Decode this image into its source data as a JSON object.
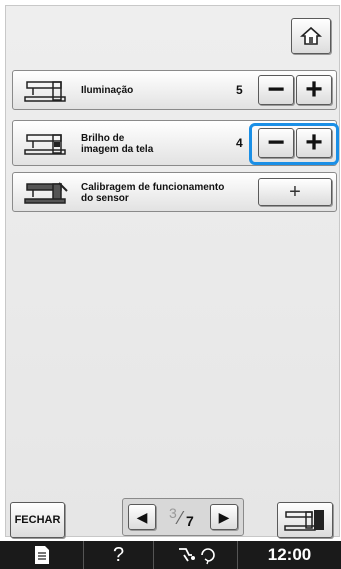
{
  "header": {
    "home_icon": "home-icon"
  },
  "settings": [
    {
      "label": "Iluminação",
      "value": "5",
      "icon": "light-machine-icon"
    },
    {
      "label": "Brilho de\nimagem da tela",
      "value": "4",
      "icon": "screen-machine-icon"
    },
    {
      "label": "Calibragem de funcionamento\ndo sensor",
      "icon": "sensor-calibration-icon",
      "button_label": "+"
    }
  ],
  "stepper": {
    "minus": "−",
    "plus": "+"
  },
  "colors": {
    "highlight": "#1a8fe6",
    "statusbar": "#1a1a1a"
  },
  "footer": {
    "close_label": "FECHAR",
    "pager": {
      "prev": "◀",
      "next": "▶",
      "current": "3",
      "total": "7"
    },
    "mode_icon": "embroidery-mode-icon"
  },
  "status_bar": {
    "help": "?",
    "time": "12:00"
  }
}
